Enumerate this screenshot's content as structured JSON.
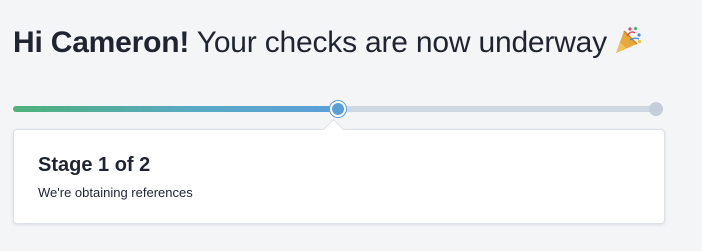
{
  "header": {
    "greeting": "Hi Cameron!",
    "message": " Your checks are now underway",
    "emoji_icon": "party-popper-icon"
  },
  "progress": {
    "current_stage": 1,
    "total_stages": 2,
    "fill_fraction": 0.5,
    "colors": {
      "fill_start": "#4db27a",
      "fill_end": "#5b9fd8",
      "track": "#cfd8e2"
    }
  },
  "stage_card": {
    "title": "Stage 1 of 2",
    "description": "We're obtaining references"
  }
}
